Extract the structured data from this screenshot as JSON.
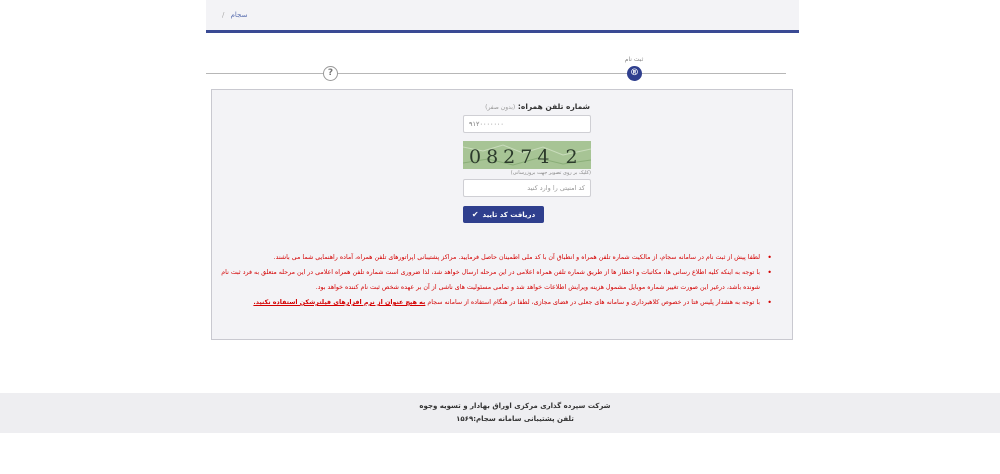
{
  "breadcrumb": {
    "home": "سجام",
    "separator": "/"
  },
  "stepper": {
    "active_label": "ثبت نام",
    "active_icon": "®",
    "next_icon": "?"
  },
  "form": {
    "phone_label": "شماره تلفن همراه:",
    "phone_hint": "(بدون صفر)",
    "phone_placeholder": "۹۱۲۰۰۰۰۰۰۰",
    "captcha_text": "08274 2",
    "captcha_note": "(کلیک بر روی تصویر جهت بروزرسانی)",
    "code_placeholder": "کد امنیتی را وارد کنید",
    "submit_label": "دریافت کد تایید"
  },
  "notes": [
    {
      "text": "لطفا پیش از ثبت نام در سامانه سجام، از مالکیت شماره تلفن همراه و انطباق آن با کد ملی اطمینان حاصل فرمایید. مراکز پشتیبانی اپراتورهای تلفن همراه، آماده راهنمایی شما می باشند."
    },
    {
      "text": "با توجه به اینکه کلیه اطلاع رسانی ها، مکاتبات و اخطار ها از طریق شماره تلفن همراه اعلامی در این مرحله ارسال خواهد شد، لذا ضروری است شماره تلفن همراه اعلامی در این مرحله متعلق به فرد ثبت نام شونده باشد، درغیر این صورت تغییر شماره موبایل مشمول هزینه ویرایش اطلاعات خواهد شد و تمامی مسئولیت های ناشی از آن بر عهده شخص ثبت نام کننده خواهد بود."
    },
    {
      "text": "با توجه به هشدار پلیس فتا در خصوص کلاهبرداری و سامانه های جعلی در فضای مجازی، لطفا در هنگام استفاده از سامانه سجام ",
      "strong": "به هیچ عنوان از نرم افزارهای فیلترشکن استفاده نکنید."
    }
  ],
  "footer": {
    "company": "شرکت سپرده گذاری مرکزی اوراق بهادار و تسویه وجوه",
    "support": "تلفن پشتیبانی سامانه سجام:۱۵۶۹"
  },
  "colors": {
    "primary": "#2f3f8e",
    "warning": "#d40000",
    "panel_bg": "#f3f3f6"
  }
}
